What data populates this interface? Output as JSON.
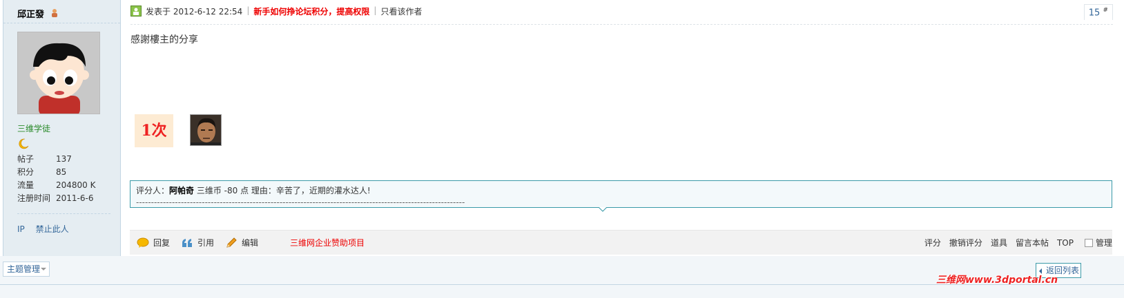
{
  "user": {
    "name": "邱正發",
    "group": "三维学徒",
    "stats": [
      {
        "label": "帖子",
        "value": "137"
      },
      {
        "label": "积分",
        "value": "85"
      },
      {
        "label": "流量",
        "value": "204800 K"
      },
      {
        "label": "注册时间",
        "value": "2011-6-6"
      }
    ],
    "ops": {
      "ip": "IP",
      "ban": "禁止此人"
    }
  },
  "post": {
    "posted_at": "发表于  2012-6-12 22:54",
    "promo_link": "新手如何挣论坛积分，提高权限",
    "only_author": "只看该作者",
    "floor": "15",
    "floor_mark": "#",
    "content": "感謝樓主的分享",
    "badge_once": "1次"
  },
  "rating": {
    "prefix": "评分人：",
    "rater": "阿帕奇",
    "detail": "  三维币  -80 点  理由：辛苦了，近期的灌水达人!",
    "dashes": "--------------------------------------------------------------------------------------------------------------"
  },
  "actions": {
    "reply": "回复",
    "quote": "引用",
    "edit": "编辑",
    "sponsor": "三维网企业赞助项目",
    "rate": "评分",
    "undo_rate": "撤销评分",
    "props": "道具",
    "message": "留言本帖",
    "top": "TOP",
    "manage": "管理"
  },
  "footer": {
    "topic_manage": "主题管理",
    "back_list": "返回列表",
    "watermark": "三维网www.3dportal.cn"
  },
  "colors": {
    "accent_red": "#ee0000",
    "link_blue": "#336699",
    "border_teal": "#3a9aa8",
    "sidebar_bg": "#e5edf2"
  }
}
